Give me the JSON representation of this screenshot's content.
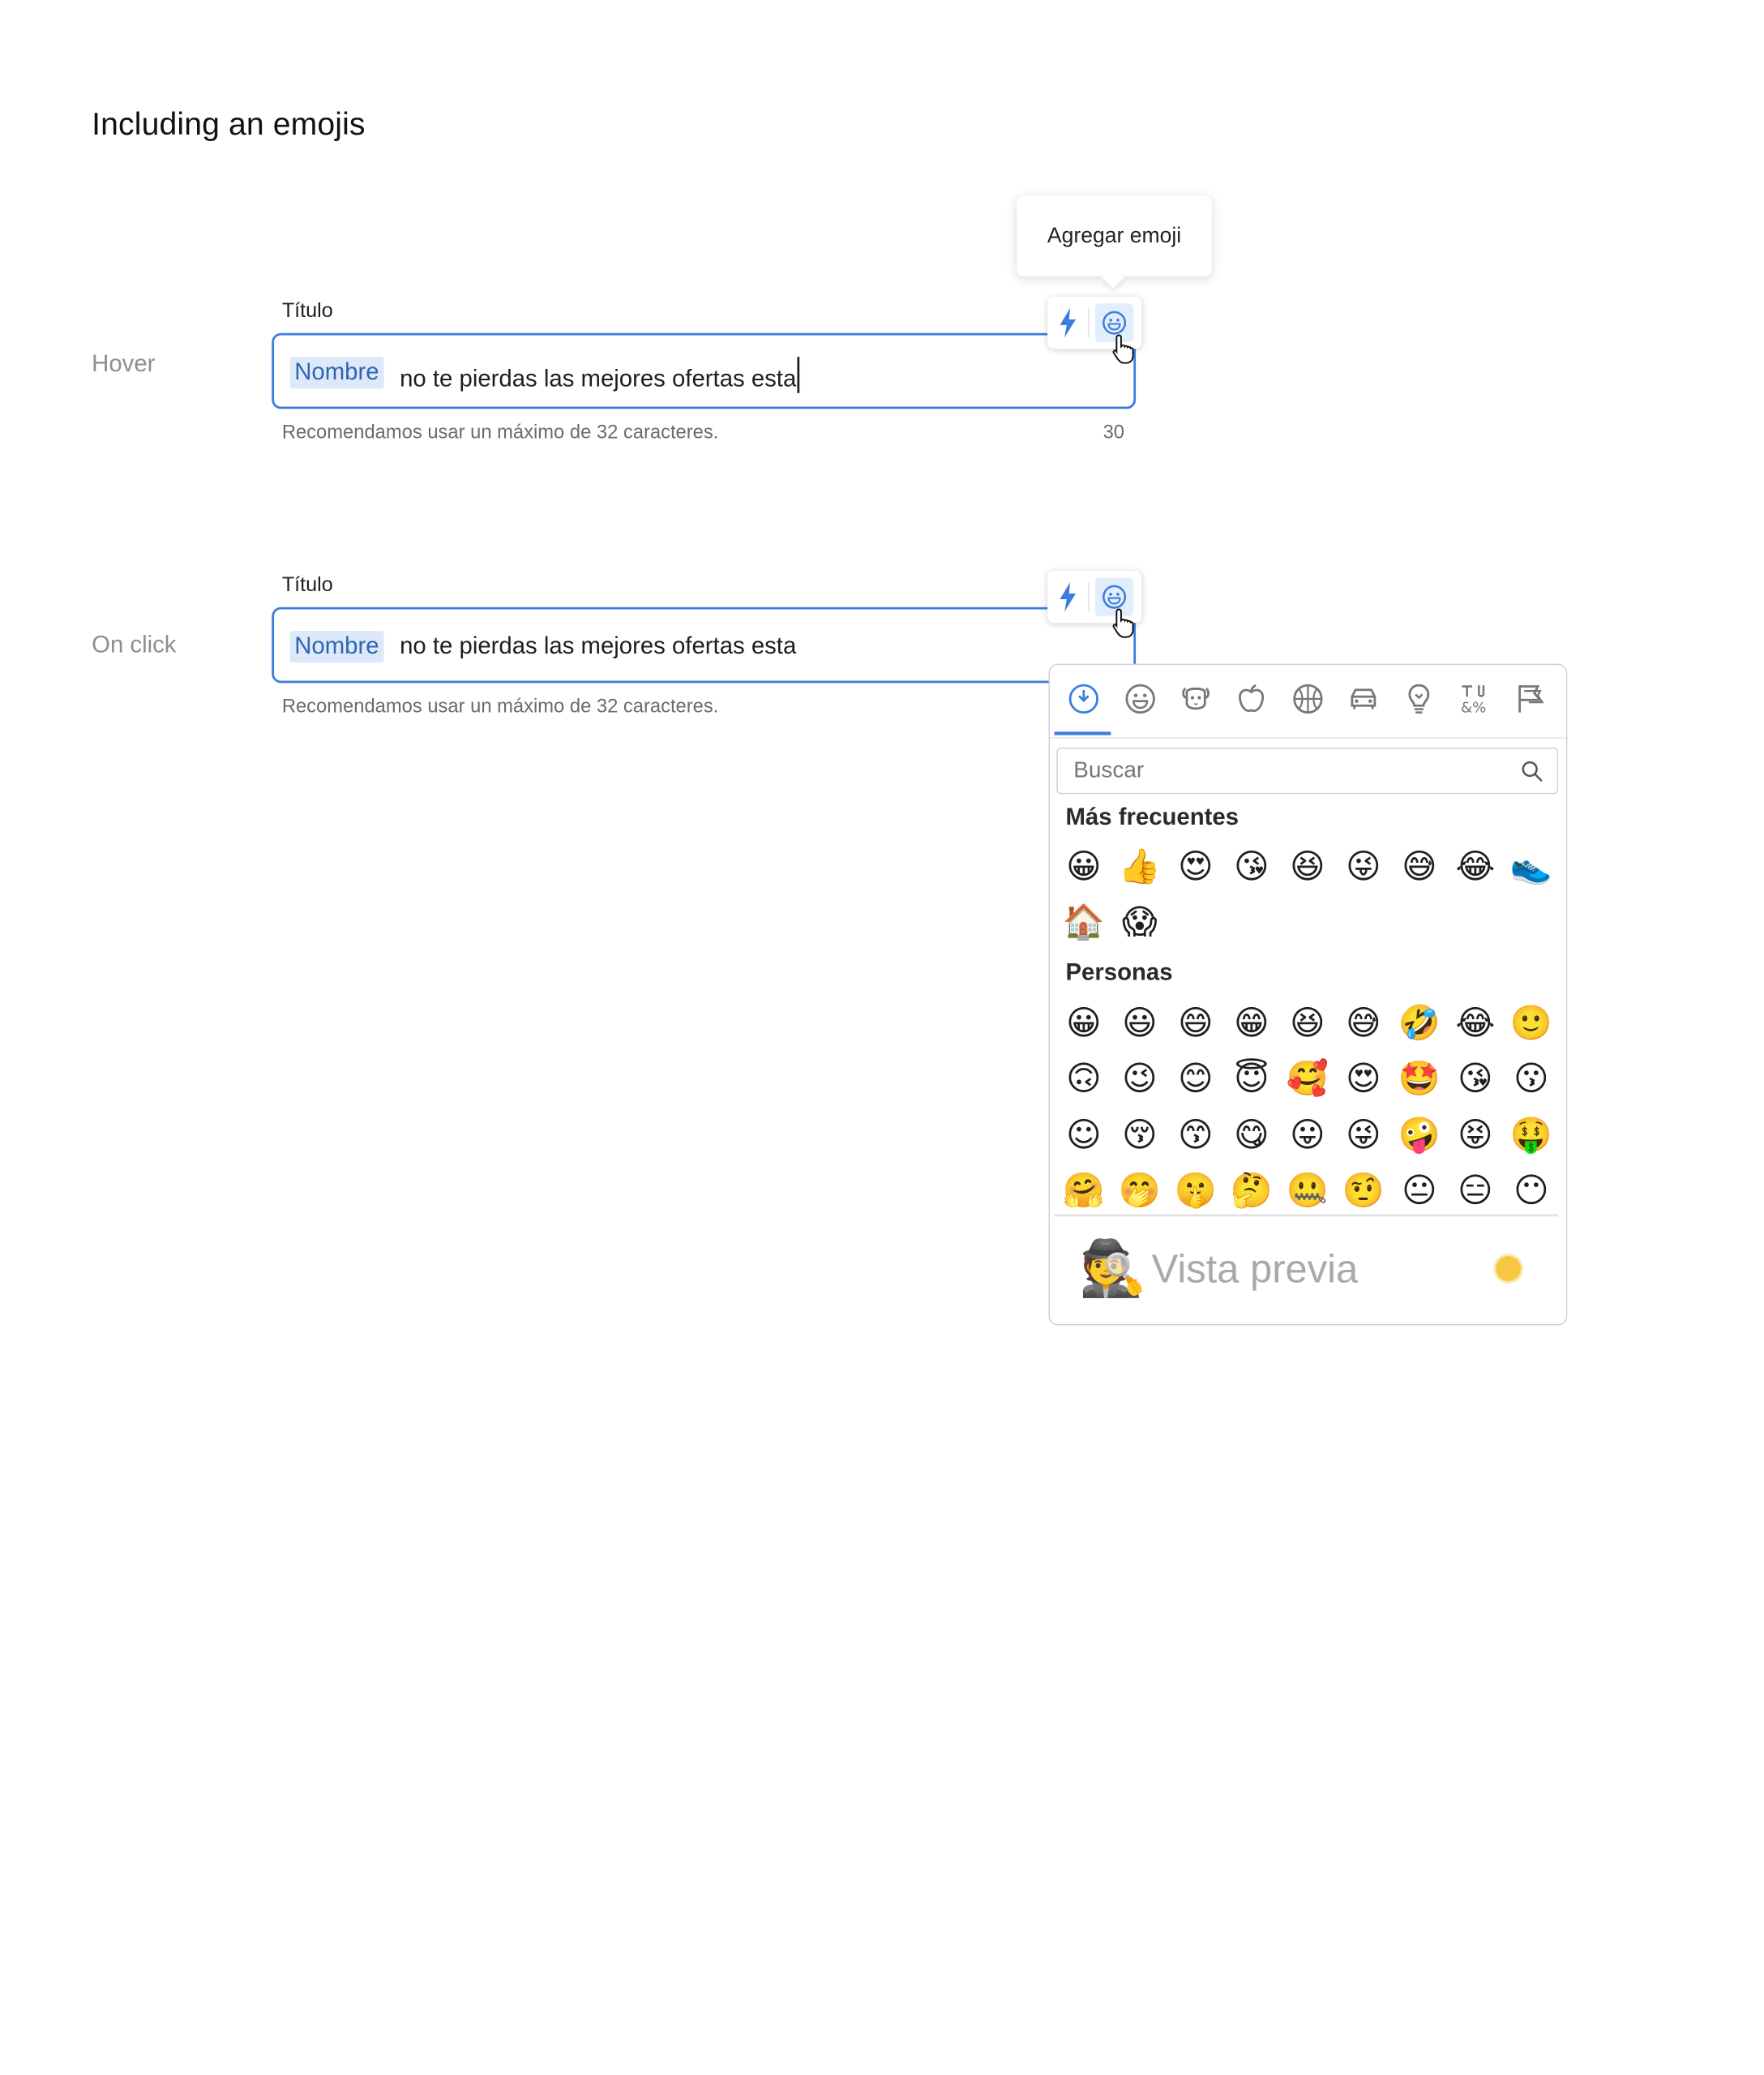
{
  "heading": "Including an emojis",
  "hover": {
    "state_label": "Hover",
    "field_label": "Título",
    "chip": "Nombre",
    "text": "no te pierdas las mejores ofertas esta",
    "helper": "Recomendamos usar un máximo de 32 caracteres.",
    "counter": "30",
    "tooltip": "Agregar emoji"
  },
  "click": {
    "state_label": "On click",
    "field_label": "Título",
    "chip": "Nombre",
    "text": "no te pierdas las mejores ofertas esta",
    "helper": "Recomendamos usar un máximo de 32 caracteres."
  },
  "toolbar_icons": [
    "lightning-bolt-icon",
    "smiley-face-icon"
  ],
  "picker": {
    "categories": [
      "recent-clock-icon",
      "smileys-icon",
      "animals-icon",
      "food-icon",
      "activity-icon",
      "travel-icon",
      "objects-icon",
      "symbols-icon",
      "flags-icon"
    ],
    "search_placeholder": "Buscar",
    "frequent_title": "Más frecuentes",
    "frequent": [
      "😀",
      "👍",
      "😍",
      "😘",
      "😆",
      "😜",
      "😅",
      "😂",
      "👟",
      "🏠",
      "😱"
    ],
    "people_title": "Personas",
    "people": [
      "😀",
      "😃",
      "😄",
      "😁",
      "😆",
      "😅",
      "🤣",
      "😂",
      "🙂",
      "🙃",
      "😉",
      "😊",
      "😇",
      "🥰",
      "😍",
      "🤩",
      "😘",
      "😗",
      "☺",
      "😚",
      "😙",
      "😋",
      "😛",
      "😜",
      "🤪",
      "😝",
      "🤑",
      "🤗",
      "🤭",
      "🤫",
      "🤔",
      "🤐",
      "🤨",
      "😐",
      "😑",
      "😶"
    ],
    "preview_emoji": "🕵",
    "preview_text": "Vista previa"
  },
  "colors": {
    "accent": "#3b7ddd",
    "chip_bg": "#dde9f8",
    "tone": "#f7c744"
  }
}
